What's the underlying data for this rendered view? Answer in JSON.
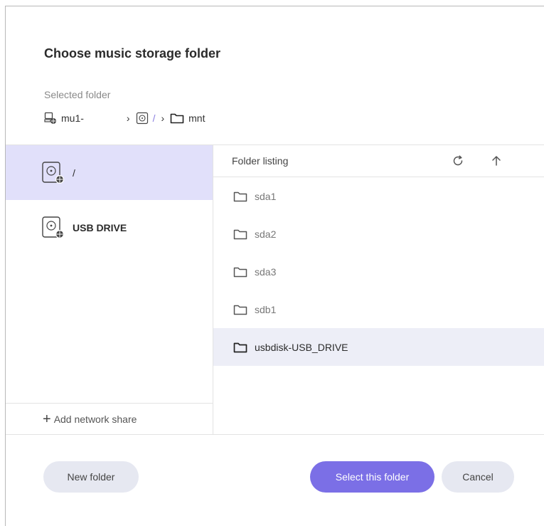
{
  "dialog": {
    "title": "Choose music storage folder",
    "selected_label": "Selected folder"
  },
  "breadcrumb": {
    "items": [
      {
        "label": "mu1-",
        "icon": "network-computer-icon"
      },
      {
        "label": "/",
        "icon": "disc-drive-icon"
      },
      {
        "label": "mnt",
        "icon": "folder-icon"
      }
    ],
    "separator": "›"
  },
  "drives": [
    {
      "label": "/",
      "icon": "hard-drive-icon",
      "active": true
    },
    {
      "label": "USB DRIVE",
      "icon": "hard-drive-icon",
      "active": false
    }
  ],
  "left_footer": {
    "add_share_label": "Add network share"
  },
  "listing": {
    "header": "Folder listing",
    "refresh_icon": "refresh-icon",
    "up_icon": "arrow-up-icon",
    "folders": [
      {
        "name": "sda1",
        "selected": false
      },
      {
        "name": "sda2",
        "selected": false
      },
      {
        "name": "sda3",
        "selected": false
      },
      {
        "name": "sdb1",
        "selected": false
      },
      {
        "name": "usbdisk-USB_DRIVE",
        "selected": true
      }
    ]
  },
  "buttons": {
    "new_folder": "New folder",
    "select_folder": "Select this folder",
    "cancel": "Cancel"
  },
  "colors": {
    "accent": "#7b6fe6",
    "active_drive_bg": "#e1e0fa",
    "selected_row_bg": "#edeef7",
    "secondary_button_bg": "#e6e8f1"
  }
}
